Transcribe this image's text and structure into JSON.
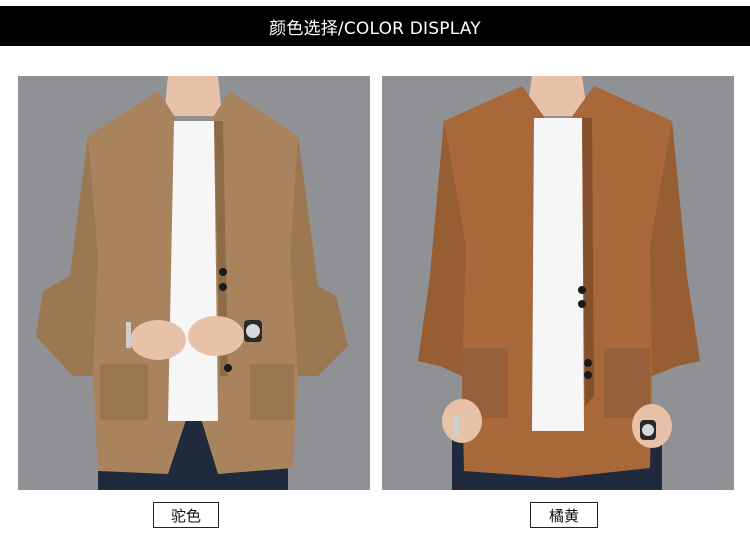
{
  "header": {
    "title": "颜色选择/COLOR DISPLAY"
  },
  "products": [
    {
      "color_name": "驼色",
      "swatch": "#a9835d"
    },
    {
      "color_name": "橘黄",
      "swatch": "#a8683a"
    }
  ],
  "colors": {
    "banner": "#000000",
    "backdrop": "#8f9195",
    "tshirt": "#f6f6f6",
    "jeans": "#1f2a3d",
    "skin": "#e8c2a8"
  }
}
